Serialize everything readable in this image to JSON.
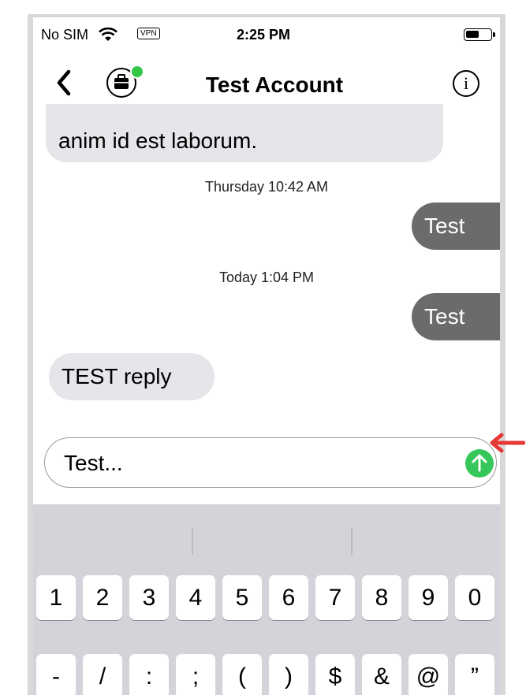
{
  "status_bar": {
    "carrier": "No SIM",
    "vpn": "VPN",
    "time": "2:25 PM"
  },
  "nav": {
    "title": "Test Account",
    "info_icon": "i"
  },
  "messages": [
    {
      "type": "incoming",
      "text": "anim id est laborum."
    },
    {
      "type": "timestamp",
      "text": "Thursday 10:42 AM"
    },
    {
      "type": "outgoing",
      "text": "Test"
    },
    {
      "type": "timestamp",
      "text": "Today 1:04 PM"
    },
    {
      "type": "outgoing",
      "text": "Test"
    },
    {
      "type": "incoming",
      "text": "TEST reply"
    }
  ],
  "composer": {
    "value": "Test..."
  },
  "keyboard": {
    "row1": [
      "1",
      "2",
      "3",
      "4",
      "5",
      "6",
      "7",
      "8",
      "9",
      "0"
    ],
    "row2": [
      "-",
      "/",
      ":",
      ";",
      "(",
      ")",
      "$",
      "&",
      "@",
      "”"
    ]
  },
  "colors": {
    "send": "#35c759",
    "presence": "#33c748",
    "annotation_arrow": "#e53935",
    "outgoing_bubble": "#6b6b6b",
    "incoming_bubble": "#e5e5ea"
  }
}
